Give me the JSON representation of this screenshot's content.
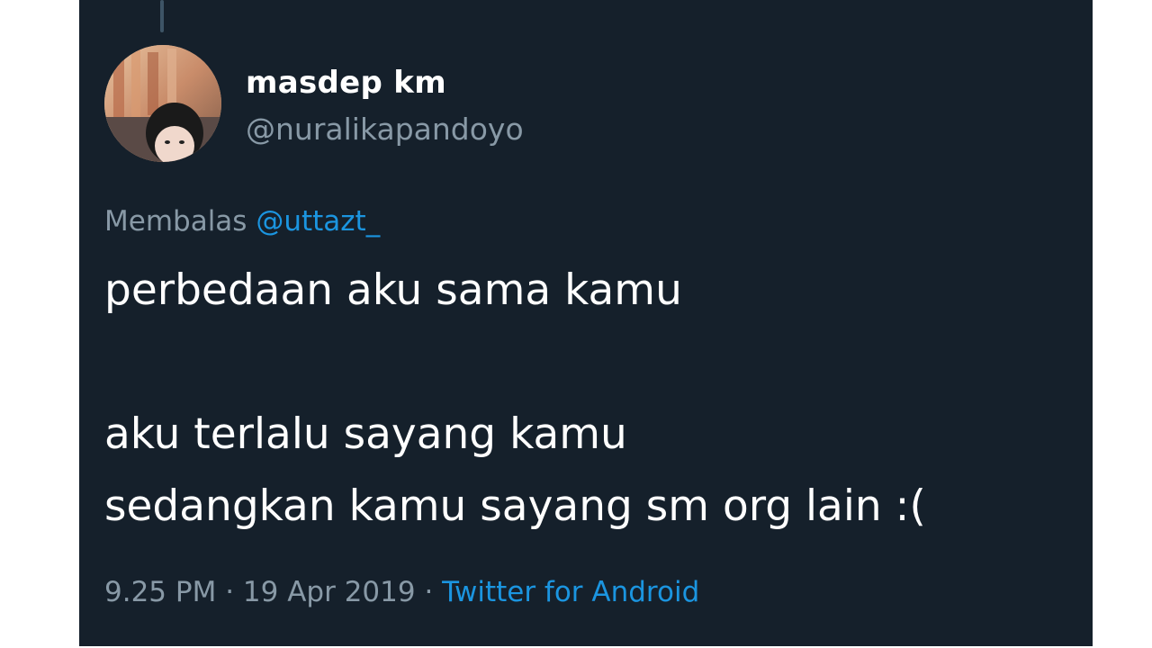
{
  "tweet": {
    "author": {
      "display_name": "masdep km",
      "handle": "@nuralikapandoyo"
    },
    "reply_prefix": "Membalas",
    "reply_to": "@uttazt_",
    "text": "perbedaan aku sama kamu\n\naku terlalu sayang kamu\nsedangkan kamu sayang sm org lain :(",
    "time": "9.25 PM",
    "separator": "·",
    "date": "19 Apr 2019",
    "source": "Twitter for Android"
  },
  "colors": {
    "background": "#15202b",
    "text": "#ffffff",
    "secondary": "#8899a6",
    "link": "#1b95e0"
  }
}
